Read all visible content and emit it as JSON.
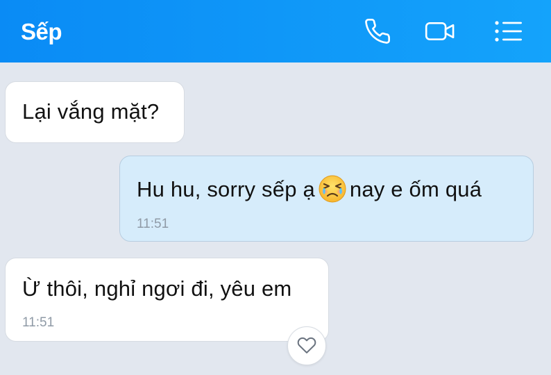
{
  "header": {
    "title": "Sếp",
    "icons": [
      "phone-icon",
      "video-call-icon",
      "menu-list-icon"
    ],
    "background": "#0a8bf5"
  },
  "messages": [
    {
      "direction": "incoming",
      "text": "Lại vắng mặt?"
    },
    {
      "direction": "outgoing",
      "text_before": "Hu hu, sorry sếp ạ",
      "emoji": "crying-face-emoji",
      "text_after": "nay e ốm quá",
      "time": "11:51"
    },
    {
      "direction": "incoming",
      "text": "Ừ thôi, nghỉ ngơi đi, yêu em",
      "time": "11:51"
    }
  ],
  "colors": {
    "chat_background": "#e2e7ef",
    "incoming_bubble": "#ffffff",
    "outgoing_bubble": "#d6ecfb",
    "timestamp": "#8f9aa6"
  },
  "reaction_button_icon": "heart-icon"
}
